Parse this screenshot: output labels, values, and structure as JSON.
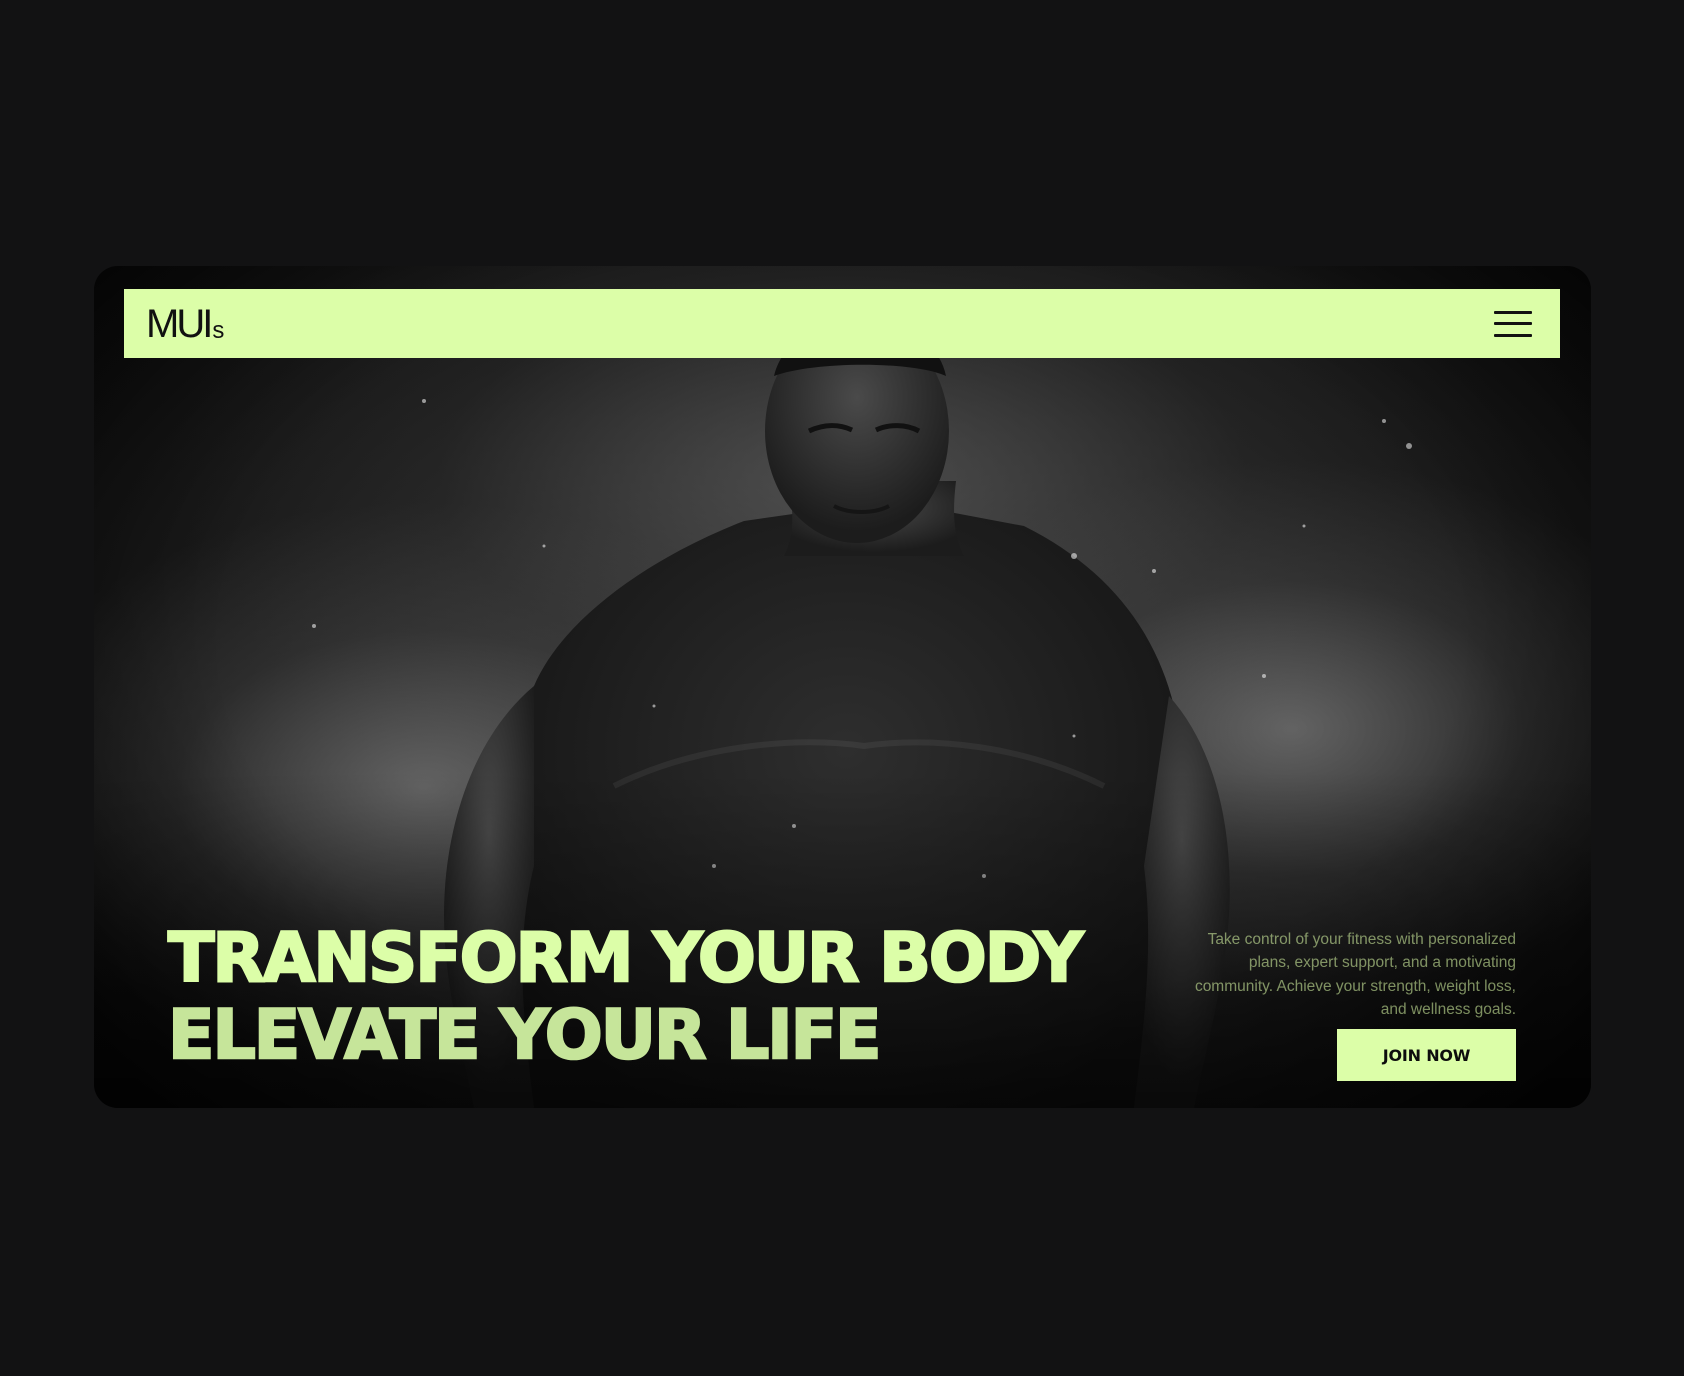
{
  "brand": {
    "logo_main": "MUI",
    "logo_sub": "s"
  },
  "nav": {
    "menu_icon": "hamburger-menu-icon"
  },
  "hero": {
    "headline_line1": "TRANSFORM YOUR BODY",
    "headline_line2": "ELEVATE YOUR LIFE",
    "tagline": "Take control of your fitness with personalized plans, expert support, and a motivating community. Achieve your strength, weight loss, and wellness goals.",
    "cta_label": "JOIN NOW"
  },
  "colors": {
    "page_background": "#121213",
    "accent": "#dcfea8",
    "accent_dim": "#c6e59a",
    "text_dark": "#111111"
  }
}
